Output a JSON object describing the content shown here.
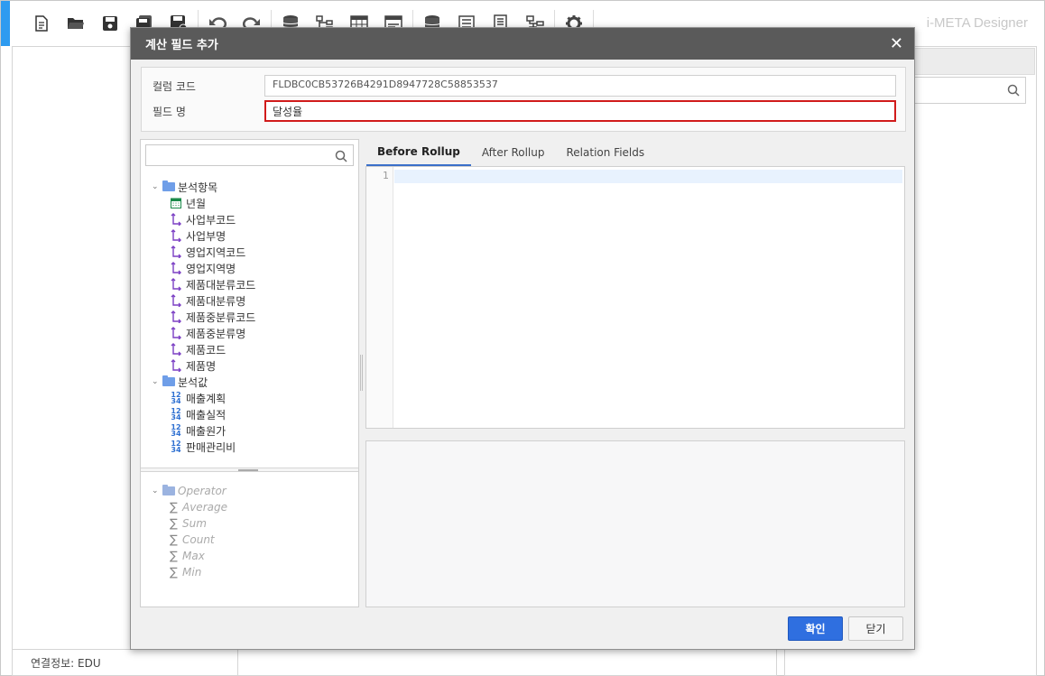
{
  "app": {
    "title": "i-META Designer",
    "status": "연결정보: EDU",
    "toolbar": [
      "new-icon",
      "open-folder-icon",
      "save-icon",
      "save-all-icon",
      "save-as-icon",
      "undo-icon",
      "redo-icon",
      "database-icon",
      "hierarchy-icon",
      "table-icon",
      "view-icon",
      "datasource-icon",
      "list-icon",
      "report-icon",
      "flow-icon",
      "settings-icon"
    ]
  },
  "dialog": {
    "title": "계산 필드 추가",
    "close": "✕",
    "column_code_label": "컬럼 코드",
    "column_code_value": "FLDBC0CB53726B4291D8947728C58853537",
    "field_name_label": "필드 명",
    "field_name_value": "달성율",
    "tabs": [
      "Before Rollup",
      "After Rollup",
      "Relation Fields"
    ],
    "editor_line": "1",
    "ok": "확인",
    "cancel": "닫기"
  },
  "tree": {
    "groups": [
      {
        "label": "분석항목",
        "items": [
          {
            "label": "년월",
            "icon": "calendar-icon"
          },
          {
            "label": "사업부코드",
            "icon": "dimension-icon"
          },
          {
            "label": "사업부명",
            "icon": "dimension-icon"
          },
          {
            "label": "영업지역코드",
            "icon": "dimension-icon"
          },
          {
            "label": "영업지역명",
            "icon": "dimension-icon"
          },
          {
            "label": "제품대분류코드",
            "icon": "dimension-icon"
          },
          {
            "label": "제품대분류명",
            "icon": "dimension-icon"
          },
          {
            "label": "제품중분류코드",
            "icon": "dimension-icon"
          },
          {
            "label": "제품중분류명",
            "icon": "dimension-icon"
          },
          {
            "label": "제품코드",
            "icon": "dimension-icon"
          },
          {
            "label": "제품명",
            "icon": "dimension-icon"
          }
        ]
      },
      {
        "label": "분석값",
        "items": [
          {
            "label": "매출계획",
            "icon": "number-icon"
          },
          {
            "label": "매출실적",
            "icon": "number-icon"
          },
          {
            "label": "매출원가",
            "icon": "number-icon"
          },
          {
            "label": "판매관리비",
            "icon": "number-icon"
          }
        ]
      }
    ],
    "operator": {
      "label": "Operator",
      "items": [
        "Average",
        "Sum",
        "Count",
        "Max",
        "Min"
      ]
    },
    "num_icon_top": "12",
    "num_icon_bottom": "34"
  }
}
